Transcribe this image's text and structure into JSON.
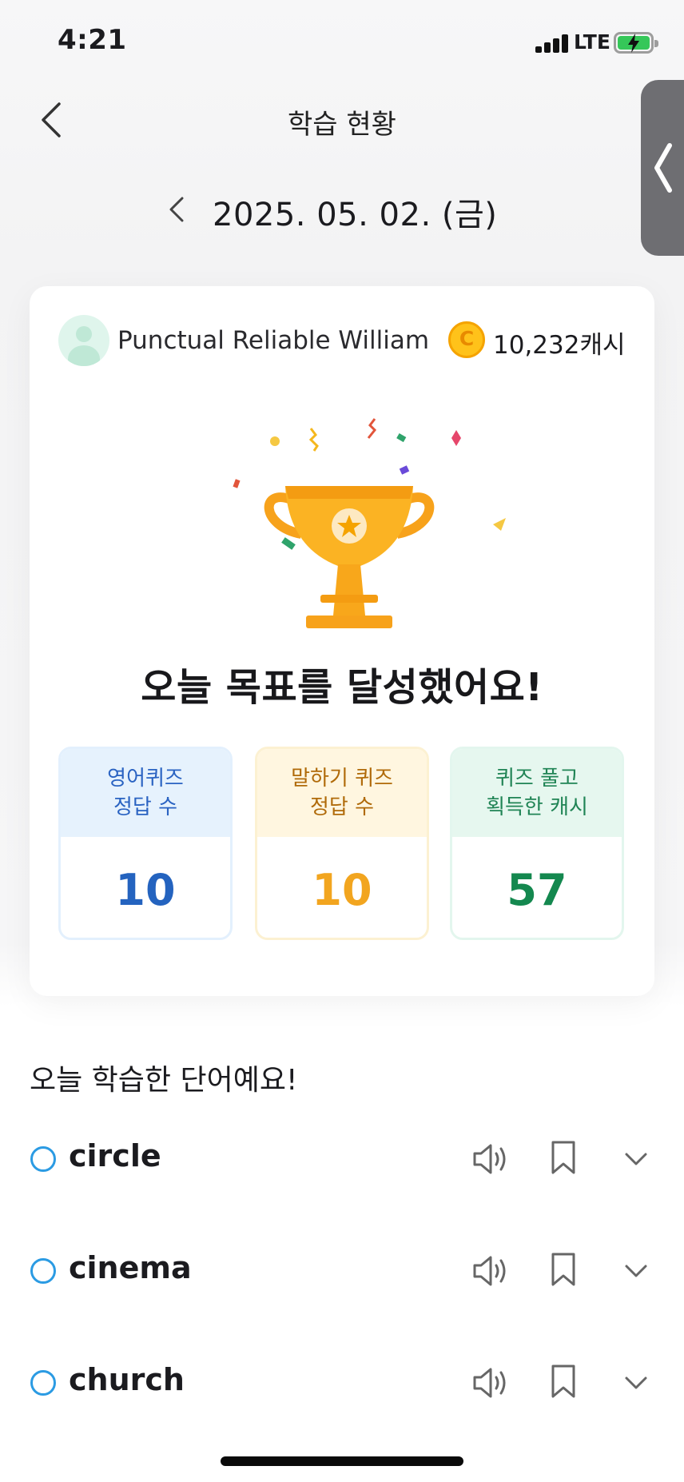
{
  "status_bar": {
    "time": "4:21",
    "network": "LTE"
  },
  "header": {
    "title": "학습 현황"
  },
  "date_nav": {
    "date": "2025. 05. 02. (금)"
  },
  "profile": {
    "name": "Punctual Reliable William",
    "cash": "10,232캐시",
    "coin_letter": "C"
  },
  "achievement": {
    "message": "오늘 목표를 달성했어요!"
  },
  "stats": [
    {
      "line1": "영어퀴즈",
      "line2": "정답 수",
      "value": "10"
    },
    {
      "line1": "말하기 퀴즈",
      "line2": "정답 수",
      "value": "10"
    },
    {
      "line1": "퀴즈 풀고",
      "line2": "획득한 캐시",
      "value": "57"
    }
  ],
  "words_section": {
    "title": "오늘 학습한 단어예요!",
    "items": [
      {
        "word": "circle"
      },
      {
        "word": "cinema"
      },
      {
        "word": "church"
      }
    ]
  },
  "colors": {
    "accent_blue": "#2463bf",
    "accent_yellow": "#f2a51f",
    "accent_green": "#14884f",
    "radio_blue": "#2b9be3",
    "trophy_gold": "#f7a21b"
  }
}
